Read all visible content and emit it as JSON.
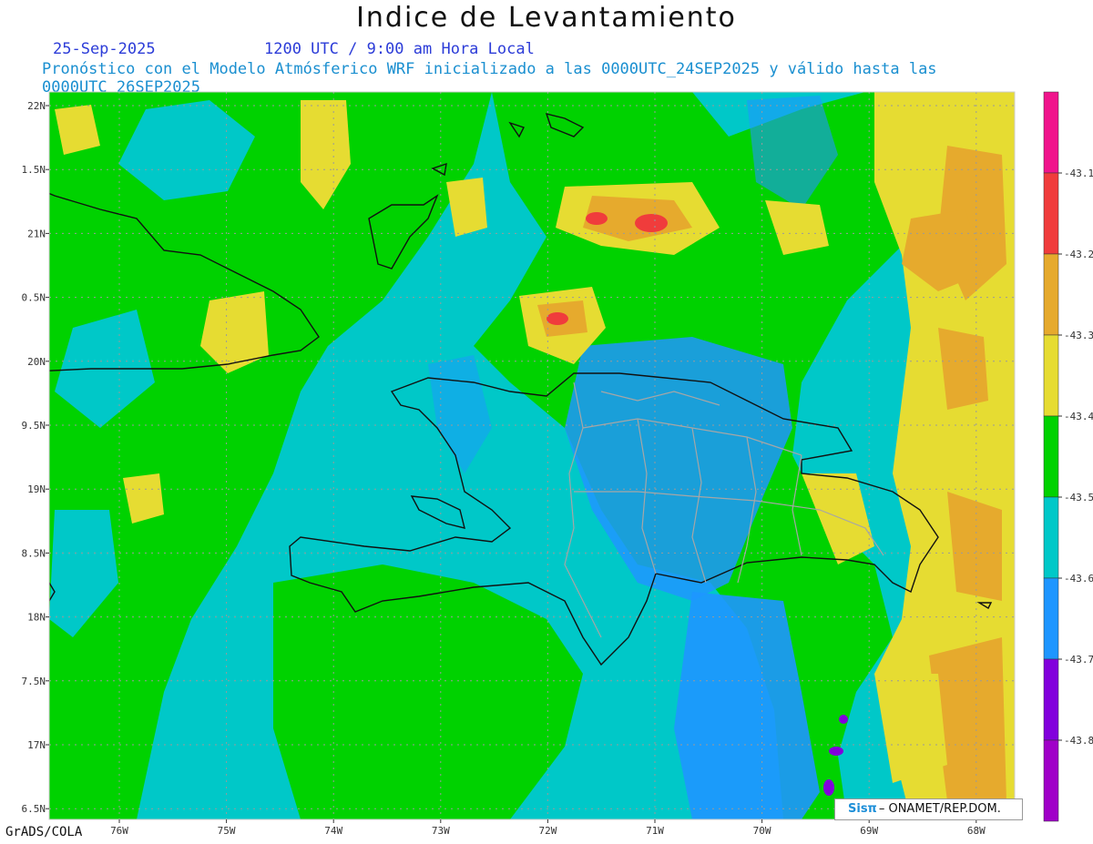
{
  "title": "Indice de Levantamiento",
  "date": "25-Sep-2025",
  "valid_time": "1200 UTC / 9:00 am Hora Local",
  "model_note": "Pronóstico con el Modelo Atmósferico WRF inicializado a las 0000UTC_24SEP2025 y válido hasta las  0000UTC_26SEP2025",
  "footer": "GrADS/COLA",
  "credit": {
    "logo": "Sisπ",
    "org": "– ONAMET/REP.DOM."
  },
  "map": {
    "lat_labels": [
      "22N",
      "1.5N",
      "21N",
      "0.5N",
      "20N",
      "9.5N",
      "19N",
      "8.5N",
      "18N",
      "7.5N",
      "17N",
      "6.5N"
    ],
    "lon_labels": [
      "76W",
      "75W",
      "74W",
      "73W",
      "72W",
      "71W",
      "70W",
      "69W",
      "68W"
    ]
  },
  "colorbar": {
    "labels": [
      "-43.1",
      "-43.2",
      "-43.3",
      "-43.4",
      "-43.5",
      "-43.6",
      "-43.7",
      "-43.8"
    ],
    "colors": [
      "#f0148c",
      "#f03c3c",
      "#e6aa2d",
      "#e6dc32",
      "#00d200",
      "#00c8c8",
      "#1e96ff",
      "#8200dc",
      "#a000c8"
    ]
  },
  "colors": {
    "deep_blue": "#1e50ff",
    "field_bg": "#00c8c8",
    "green": "#00d200",
    "yellow": "#e6dc32",
    "orange": "#e6aa2d",
    "red": "#f03c3c"
  }
}
